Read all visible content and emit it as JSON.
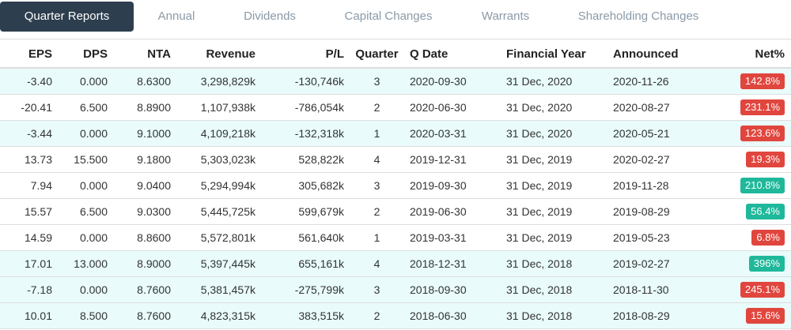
{
  "tabs": [
    {
      "label": "Quarter Reports",
      "active": true
    },
    {
      "label": "Annual",
      "active": false
    },
    {
      "label": "Dividends",
      "active": false
    },
    {
      "label": "Capital Changes",
      "active": false
    },
    {
      "label": "Warrants",
      "active": false
    },
    {
      "label": "Shareholding Changes",
      "active": false
    }
  ],
  "table": {
    "headers": [
      "EPS",
      "DPS",
      "NTA",
      "Revenue",
      "P/L",
      "Quarter",
      "Q Date",
      "Financial Year",
      "Announced",
      "Net%"
    ],
    "rows": [
      {
        "eps": "-3.40",
        "dps": "0.000",
        "nta": "8.6300",
        "revenue": "3,298,829k",
        "pl": "-130,746k",
        "quarter": "3",
        "qdate": "2020-09-30",
        "fy": "31 Dec, 2020",
        "announced": "2020-11-26",
        "net": "142.8%",
        "net_status": "negative",
        "highlight": true
      },
      {
        "eps": "-20.41",
        "dps": "6.500",
        "nta": "8.8900",
        "revenue": "1,107,938k",
        "pl": "-786,054k",
        "quarter": "2",
        "qdate": "2020-06-30",
        "fy": "31 Dec, 2020",
        "announced": "2020-08-27",
        "net": "231.1%",
        "net_status": "negative",
        "highlight": false
      },
      {
        "eps": "-3.44",
        "dps": "0.000",
        "nta": "9.1000",
        "revenue": "4,109,218k",
        "pl": "-132,318k",
        "quarter": "1",
        "qdate": "2020-03-31",
        "fy": "31 Dec, 2020",
        "announced": "2020-05-21",
        "net": "123.6%",
        "net_status": "negative",
        "highlight": true
      },
      {
        "eps": "13.73",
        "dps": "15.500",
        "nta": "9.1800",
        "revenue": "5,303,023k",
        "pl": "528,822k",
        "quarter": "4",
        "qdate": "2019-12-31",
        "fy": "31 Dec, 2019",
        "announced": "2020-02-27",
        "net": "19.3%",
        "net_status": "negative",
        "highlight": false
      },
      {
        "eps": "7.94",
        "dps": "0.000",
        "nta": "9.0400",
        "revenue": "5,294,994k",
        "pl": "305,682k",
        "quarter": "3",
        "qdate": "2019-09-30",
        "fy": "31 Dec, 2019",
        "announced": "2019-11-28",
        "net": "210.8%",
        "net_status": "positive",
        "highlight": false
      },
      {
        "eps": "15.57",
        "dps": "6.500",
        "nta": "9.0300",
        "revenue": "5,445,725k",
        "pl": "599,679k",
        "quarter": "2",
        "qdate": "2019-06-30",
        "fy": "31 Dec, 2019",
        "announced": "2019-08-29",
        "net": "56.4%",
        "net_status": "positive",
        "highlight": false
      },
      {
        "eps": "14.59",
        "dps": "0.000",
        "nta": "8.8600",
        "revenue": "5,572,801k",
        "pl": "561,640k",
        "quarter": "1",
        "qdate": "2019-03-31",
        "fy": "31 Dec, 2019",
        "announced": "2019-05-23",
        "net": "6.8%",
        "net_status": "negative",
        "highlight": false
      },
      {
        "eps": "17.01",
        "dps": "13.000",
        "nta": "8.9000",
        "revenue": "5,397,445k",
        "pl": "655,161k",
        "quarter": "4",
        "qdate": "2018-12-31",
        "fy": "31 Dec, 2018",
        "announced": "2019-02-27",
        "net": "396%",
        "net_status": "positive",
        "highlight": true
      },
      {
        "eps": "-7.18",
        "dps": "0.000",
        "nta": "8.7600",
        "revenue": "5,381,457k",
        "pl": "-275,799k",
        "quarter": "3",
        "qdate": "2018-09-30",
        "fy": "31 Dec, 2018",
        "announced": "2018-11-30",
        "net": "245.1%",
        "net_status": "negative",
        "highlight": true
      },
      {
        "eps": "10.01",
        "dps": "8.500",
        "nta": "8.7600",
        "revenue": "4,823,315k",
        "pl": "383,515k",
        "quarter": "2",
        "qdate": "2018-06-30",
        "fy": "31 Dec, 2018",
        "announced": "2018-08-29",
        "net": "15.6%",
        "net_status": "negative",
        "highlight": true
      }
    ]
  },
  "colors": {
    "tab_active_bg": "#2d3e4e",
    "tab_inactive_text": "#8a9aa8",
    "row_highlight": "#e9fbfb",
    "badge_negative": "#e0463e",
    "badge_positive": "#1fb89a"
  }
}
